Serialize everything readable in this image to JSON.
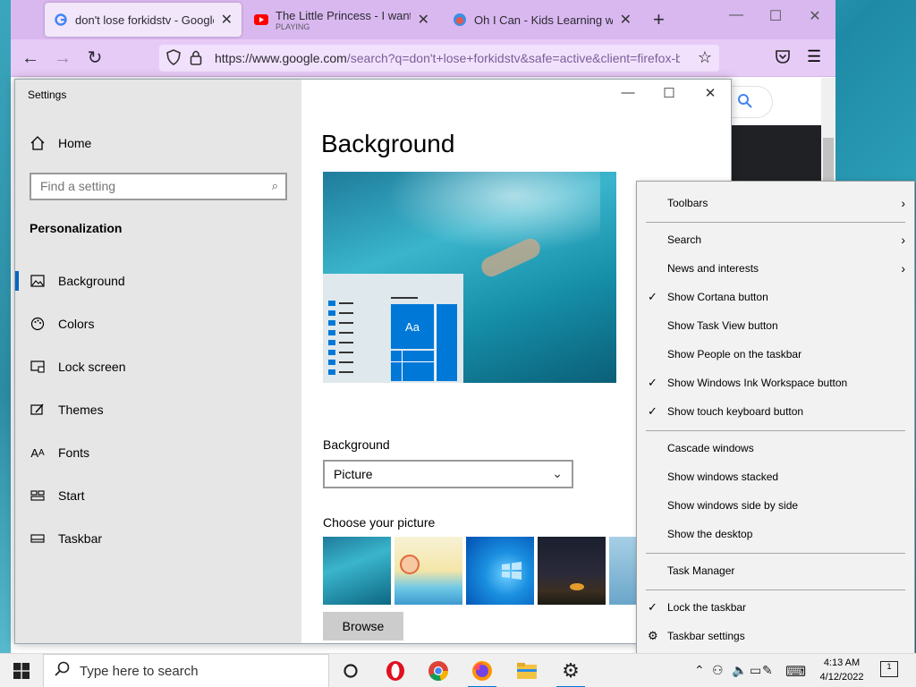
{
  "browser": {
    "tabs": [
      {
        "title": "don't lose forkidstv - Google Se",
        "subtitle": "",
        "active": true
      },
      {
        "title": "The Little Princess - I want to sw",
        "subtitle": "PLAYING",
        "active": false
      },
      {
        "title": "Oh I Can - Kids Learning with F",
        "subtitle": "",
        "active": false
      }
    ],
    "new_tab": "+",
    "url_host": "https://www.google.com",
    "url_path": "/search?q=don't+lose+forkidstv&safe=active&client=firefox-b"
  },
  "settings": {
    "window_title": "Settings",
    "home_label": "Home",
    "search_placeholder": "Find a setting",
    "section": "Personalization",
    "nav": [
      {
        "label": "Background",
        "icon": "picture-icon"
      },
      {
        "label": "Colors",
        "icon": "palette-icon"
      },
      {
        "label": "Lock screen",
        "icon": "lock-screen-icon"
      },
      {
        "label": "Themes",
        "icon": "themes-icon"
      },
      {
        "label": "Fonts",
        "icon": "fonts-icon"
      },
      {
        "label": "Start",
        "icon": "start-icon"
      },
      {
        "label": "Taskbar",
        "icon": "taskbar-icon"
      }
    ],
    "page_title": "Background",
    "preview_tile": "Aa",
    "background_label": "Background",
    "background_value": "Picture",
    "choose_label": "Choose your picture",
    "browse_label": "Browse"
  },
  "context_menu": {
    "items": [
      {
        "label": "Toolbars",
        "checked": false,
        "submenu": true
      },
      {
        "label": "Search",
        "checked": false,
        "submenu": true
      },
      {
        "label": "News and interests",
        "checked": false,
        "submenu": true
      },
      {
        "label": "Show Cortana button",
        "checked": true,
        "submenu": false
      },
      {
        "label": "Show Task View button",
        "checked": false,
        "submenu": false
      },
      {
        "label": "Show People on the taskbar",
        "checked": false,
        "submenu": false
      },
      {
        "label": "Show Windows Ink Workspace button",
        "checked": true,
        "submenu": false
      },
      {
        "label": "Show touch keyboard button",
        "checked": true,
        "submenu": false
      },
      {
        "label": "Cascade windows",
        "checked": false,
        "submenu": false
      },
      {
        "label": "Show windows stacked",
        "checked": false,
        "submenu": false
      },
      {
        "label": "Show windows side by side",
        "checked": false,
        "submenu": false
      },
      {
        "label": "Show the desktop",
        "checked": false,
        "submenu": false
      },
      {
        "label": "Task Manager",
        "checked": false,
        "submenu": false
      },
      {
        "label": "Lock the taskbar",
        "checked": true,
        "submenu": false
      },
      {
        "label": "Taskbar settings",
        "checked": false,
        "submenu": false
      }
    ]
  },
  "taskbar": {
    "search_placeholder": "Type here to search",
    "time": "4:13 AM",
    "date": "4/12/2022",
    "notification_count": "1"
  },
  "colors": {
    "accent": "#0078d7",
    "tab_strip": "#d9b8ef"
  }
}
